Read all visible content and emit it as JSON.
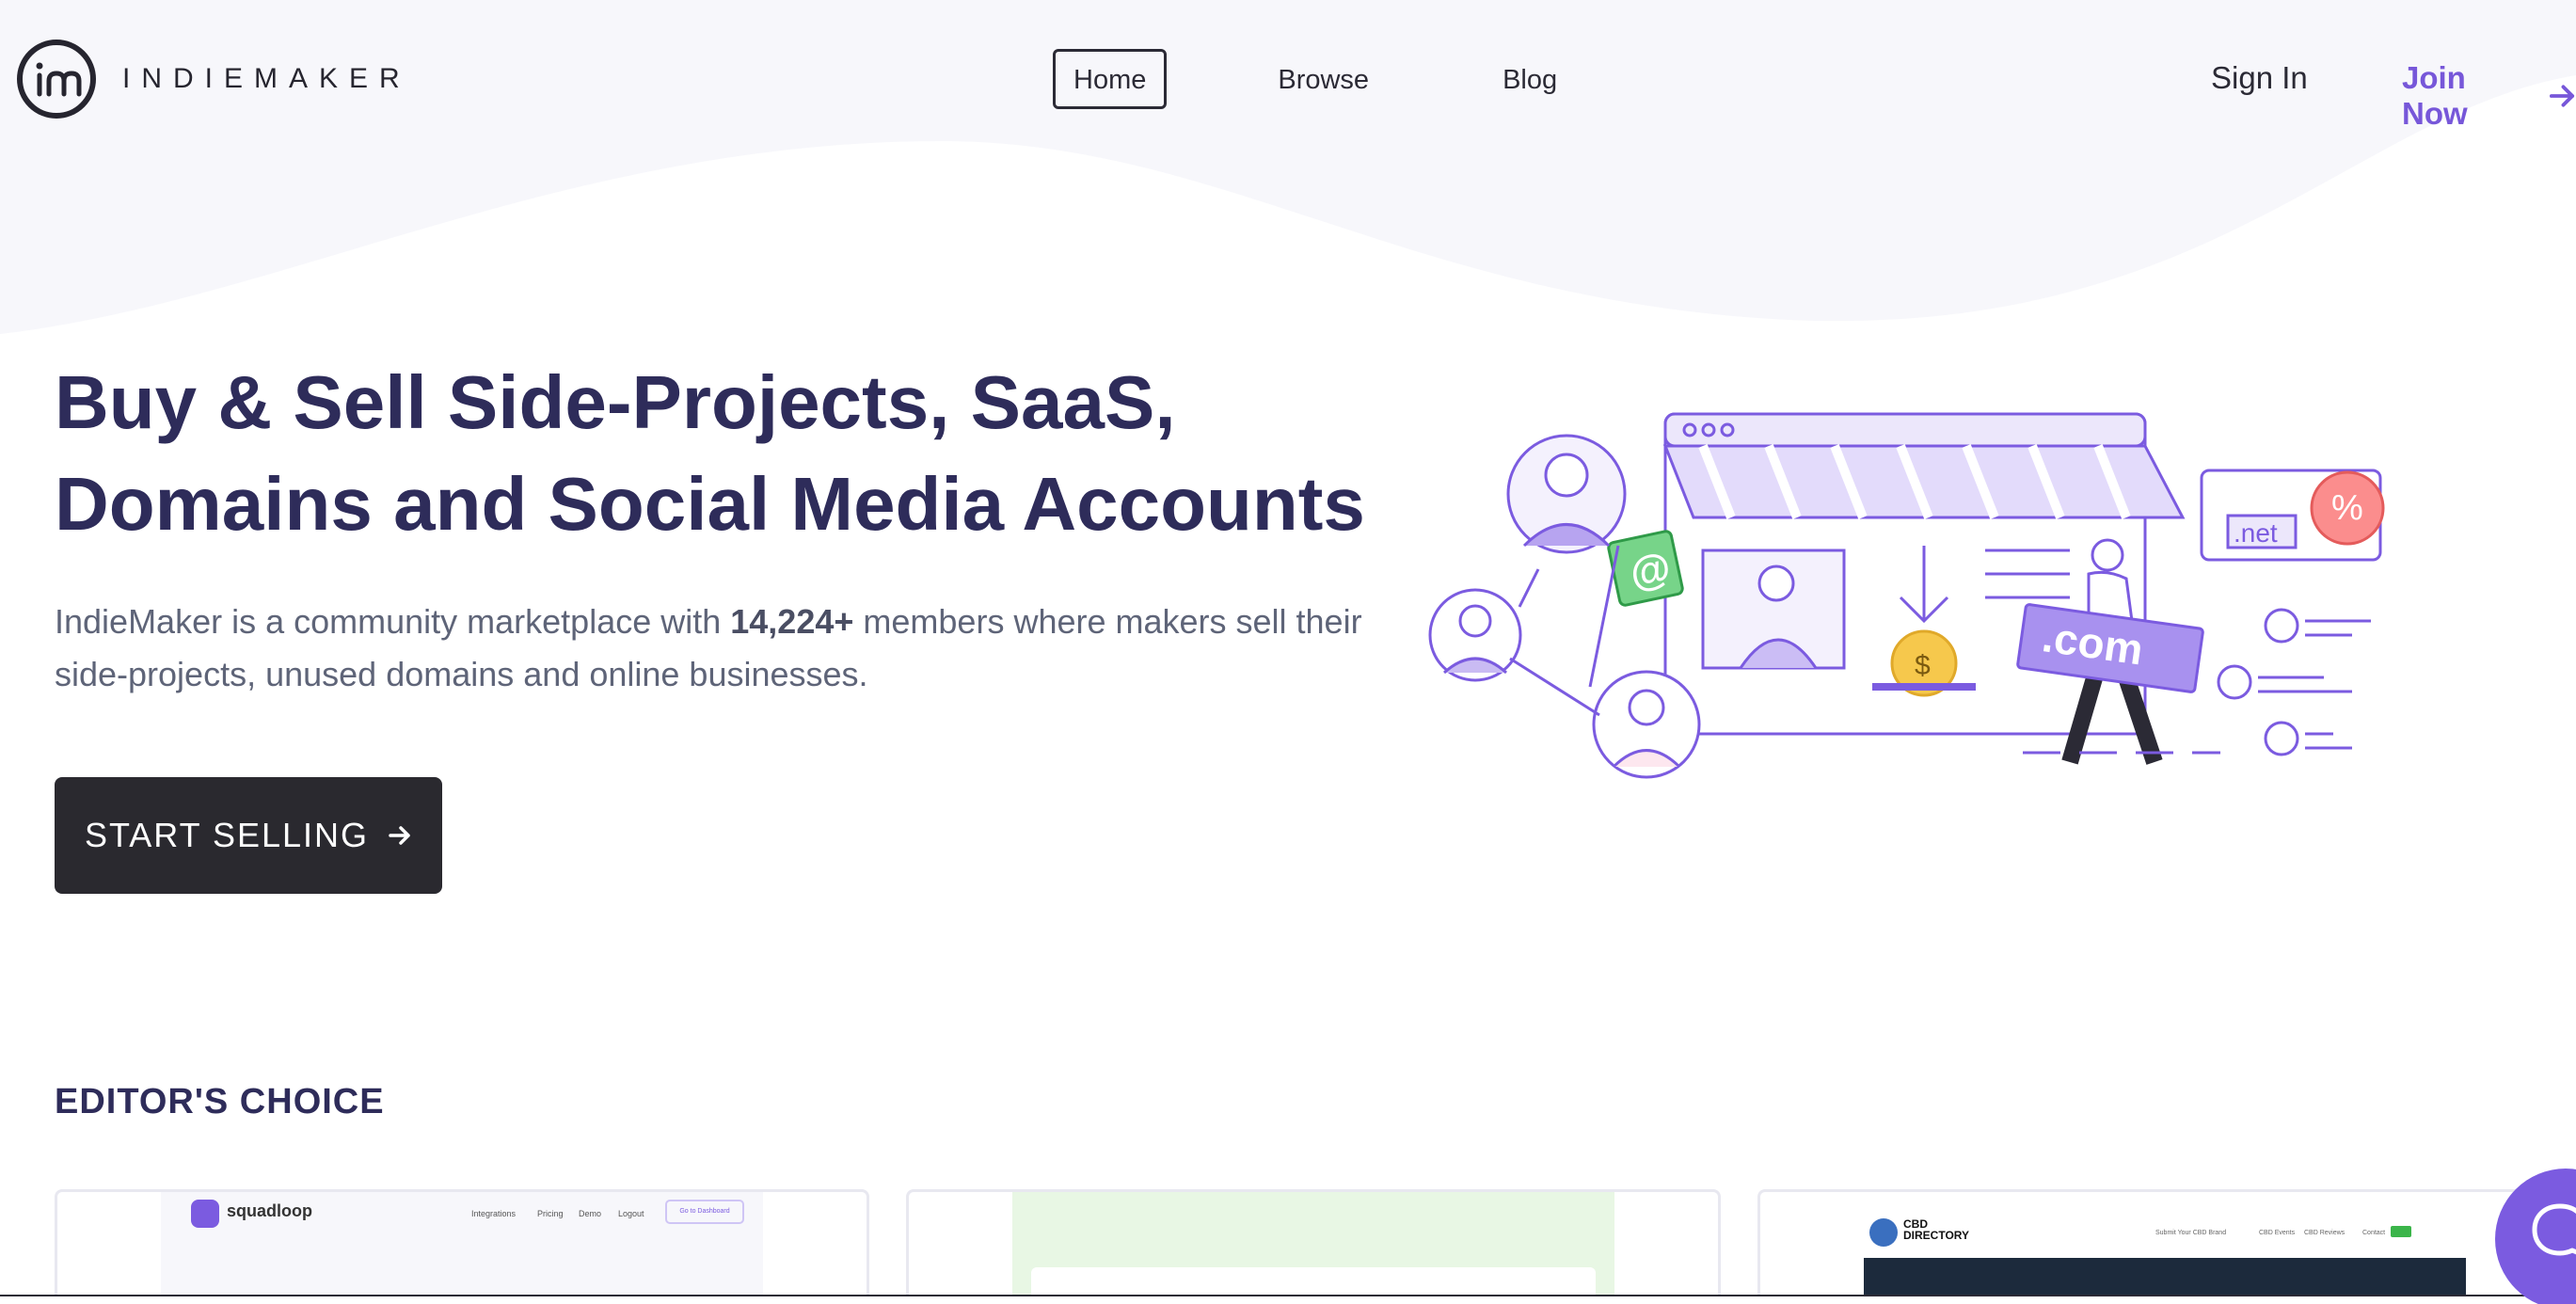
{
  "header": {
    "logo_text": "INDIEMAKER",
    "nav": {
      "home": "Home",
      "browse": "Browse",
      "blog": "Blog"
    },
    "sign_in": "Sign In",
    "join_now": "Join Now"
  },
  "hero": {
    "title_line1": "Buy & Sell Side-Projects, SaaS,",
    "title_line2": "Domains and Social Media Accounts",
    "desc_before": "IndieMaker is a community marketplace with ",
    "desc_count": "14,224+",
    "desc_after": " members where makers sell their side-projects, unused domains and online businesses.",
    "cta": "START SELLING",
    "illustration_labels": {
      "at": "@",
      "dollar": "$",
      "com": ".com",
      "net": ".net",
      "percent": "%"
    }
  },
  "editors_choice": {
    "title": "EDITOR'S CHOICE",
    "cards": [
      {
        "brand": "squadloop",
        "nav": [
          "Integrations",
          "Pricing",
          "Demo",
          "Logout"
        ],
        "button": "Go to Dashboard"
      },
      {},
      {
        "brand_line1": "CBD",
        "brand_line2": "DIRECTORY",
        "nav": [
          "Submit Your CBD Brand",
          "CBD Events",
          "CBD Reviews",
          "Contact"
        ]
      }
    ]
  },
  "colors": {
    "brand_purple": "#7757d9",
    "dark": "#2a292f",
    "heading": "#2e2c5a",
    "wave": "#f7f7fb"
  },
  "icons": {
    "logo": "indiemaker-logo-icon",
    "join_arrow": "arrow-right-icon",
    "cta_arrow": "arrow-right-icon",
    "chat": "chat-bubble-icon"
  }
}
